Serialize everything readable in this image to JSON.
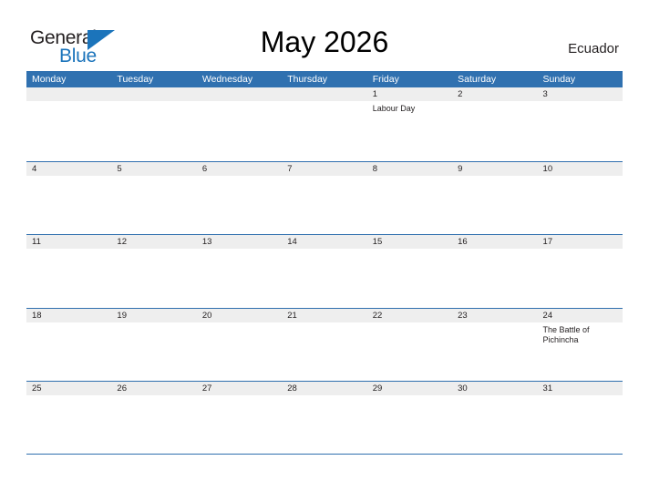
{
  "brand": {
    "name_part1": "General",
    "name_part2": "Blue",
    "flag_icon": "blue-triangle-flag-icon"
  },
  "header": {
    "title": "May 2026",
    "country": "Ecuador"
  },
  "calendar": {
    "weekdays": [
      "Monday",
      "Tuesday",
      "Wednesday",
      "Thursday",
      "Friday",
      "Saturday",
      "Sunday"
    ],
    "weeks": [
      [
        {
          "day": "",
          "events": []
        },
        {
          "day": "",
          "events": []
        },
        {
          "day": "",
          "events": []
        },
        {
          "day": "",
          "events": []
        },
        {
          "day": "1",
          "events": [
            "Labour Day"
          ]
        },
        {
          "day": "2",
          "events": []
        },
        {
          "day": "3",
          "events": []
        }
      ],
      [
        {
          "day": "4",
          "events": []
        },
        {
          "day": "5",
          "events": []
        },
        {
          "day": "6",
          "events": []
        },
        {
          "day": "7",
          "events": []
        },
        {
          "day": "8",
          "events": []
        },
        {
          "day": "9",
          "events": []
        },
        {
          "day": "10",
          "events": []
        }
      ],
      [
        {
          "day": "11",
          "events": []
        },
        {
          "day": "12",
          "events": []
        },
        {
          "day": "13",
          "events": []
        },
        {
          "day": "14",
          "events": []
        },
        {
          "day": "15",
          "events": []
        },
        {
          "day": "16",
          "events": []
        },
        {
          "day": "17",
          "events": []
        }
      ],
      [
        {
          "day": "18",
          "events": []
        },
        {
          "day": "19",
          "events": []
        },
        {
          "day": "20",
          "events": []
        },
        {
          "day": "21",
          "events": []
        },
        {
          "day": "22",
          "events": []
        },
        {
          "day": "23",
          "events": []
        },
        {
          "day": "24",
          "events": [
            "The Battle of Pichincha"
          ]
        }
      ],
      [
        {
          "day": "25",
          "events": []
        },
        {
          "day": "26",
          "events": []
        },
        {
          "day": "27",
          "events": []
        },
        {
          "day": "28",
          "events": []
        },
        {
          "day": "29",
          "events": []
        },
        {
          "day": "30",
          "events": []
        },
        {
          "day": "31",
          "events": []
        }
      ]
    ]
  },
  "colors": {
    "header_blue": "#3071b0",
    "grid_line_blue": "#2f6fae",
    "day_band_gray": "#eeeeee",
    "brand_blue": "#1b74bb",
    "text_dark": "#231f20"
  }
}
